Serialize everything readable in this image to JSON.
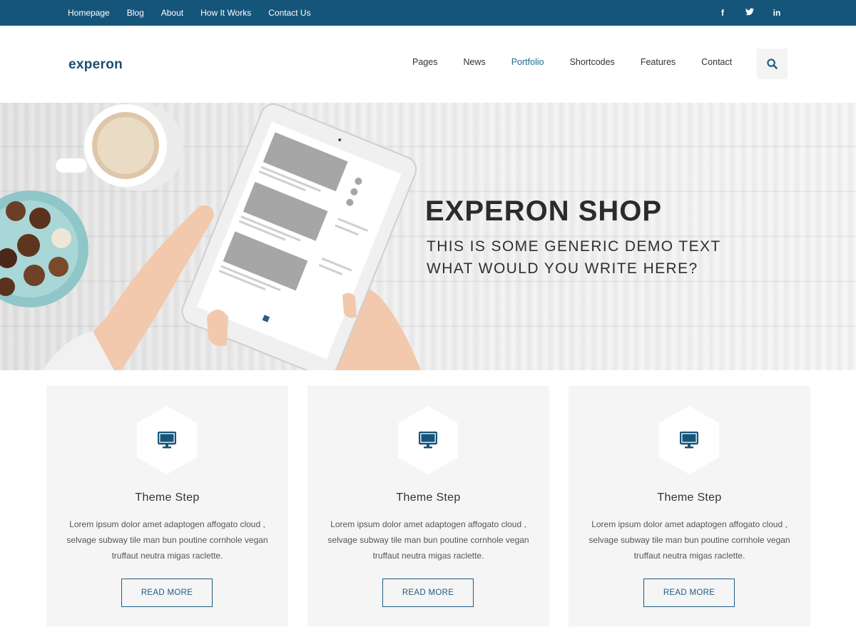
{
  "topbar": {
    "links": [
      "Homepage",
      "Blog",
      "About",
      "How It Works",
      "Contact Us"
    ],
    "social": [
      {
        "icon": "facebook-icon",
        "glyph": "f"
      },
      {
        "icon": "twitter-icon",
        "glyph": "t"
      },
      {
        "icon": "linkedin-icon",
        "glyph": "in"
      }
    ]
  },
  "header": {
    "logo": "experon",
    "nav": [
      "Pages",
      "News",
      "Portfolio",
      "Shortcodes",
      "Features",
      "Contact"
    ],
    "active_nav": "Portfolio",
    "search_icon": "search-icon"
  },
  "hero": {
    "title": "EXPERON SHOP",
    "subtitle_line1": "THIS IS SOME GENERIC DEMO TEXT",
    "subtitle_line2": "WHAT WOULD YOU WRITE HERE?"
  },
  "cards": [
    {
      "icon": "monitor-icon",
      "title": "Theme Step",
      "text": "Lorem ipsum dolor amet adaptogen affogato cloud , selvage subway tile man bun poutine cornhole vegan truffaut neutra migas raclette.",
      "button": "READ MORE"
    },
    {
      "icon": "monitor-icon",
      "title": "Theme Step",
      "text": "Lorem ipsum dolor amet adaptogen affogato cloud , selvage subway tile man bun poutine cornhole vegan truffaut neutra migas raclette.",
      "button": "READ MORE"
    },
    {
      "icon": "monitor-icon",
      "title": "Theme Step",
      "text": "Lorem ipsum dolor amet adaptogen affogato cloud , selvage subway tile man bun poutine cornhole vegan truffaut neutra migas raclette.",
      "button": "READ MORE"
    }
  ],
  "colors": {
    "topbar_bg": "#16557a",
    "accent": "#1f5a80",
    "logo": "#1b4d6e",
    "card_bg": "#f5f5f5"
  }
}
